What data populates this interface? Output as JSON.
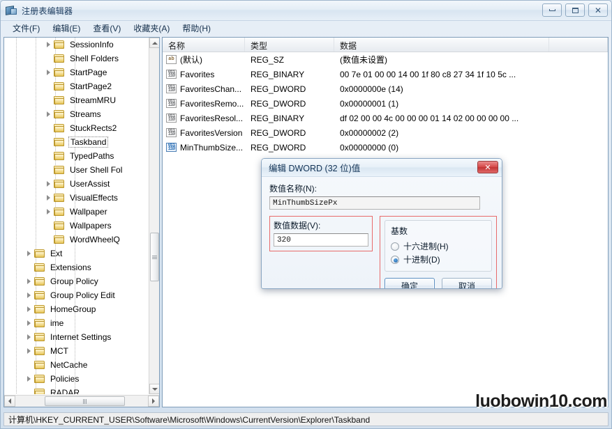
{
  "window": {
    "title": "注册表编辑器",
    "icon": "registry-editor-icon",
    "buttons": {
      "minimize": "–",
      "maximize": "❐",
      "close": "✕"
    }
  },
  "menu": [
    {
      "label": "文件(F)"
    },
    {
      "label": "编辑(E)"
    },
    {
      "label": "查看(V)"
    },
    {
      "label": "收藏夹(A)"
    },
    {
      "label": "帮助(H)"
    }
  ],
  "tree": {
    "items": [
      {
        "label": "SessionInfo",
        "indent": 2,
        "expandable": true,
        "selected": false
      },
      {
        "label": "Shell Folders",
        "indent": 2,
        "expandable": false,
        "selected": false
      },
      {
        "label": "StartPage",
        "indent": 2,
        "expandable": true,
        "selected": false
      },
      {
        "label": "StartPage2",
        "indent": 2,
        "expandable": false,
        "selected": false
      },
      {
        "label": "StreamMRU",
        "indent": 2,
        "expandable": false,
        "selected": false
      },
      {
        "label": "Streams",
        "indent": 2,
        "expandable": true,
        "selected": false
      },
      {
        "label": "StuckRects2",
        "indent": 2,
        "expandable": false,
        "selected": false
      },
      {
        "label": "Taskband",
        "indent": 2,
        "expandable": false,
        "selected": true
      },
      {
        "label": "TypedPaths",
        "indent": 2,
        "expandable": false,
        "selected": false
      },
      {
        "label": "User Shell Fol",
        "indent": 2,
        "expandable": false,
        "selected": false
      },
      {
        "label": "UserAssist",
        "indent": 2,
        "expandable": true,
        "selected": false
      },
      {
        "label": "VisualEffects",
        "indent": 2,
        "expandable": true,
        "selected": false
      },
      {
        "label": "Wallpaper",
        "indent": 2,
        "expandable": true,
        "selected": false
      },
      {
        "label": "Wallpapers",
        "indent": 2,
        "expandable": false,
        "selected": false
      },
      {
        "label": "WordWheelQ",
        "indent": 2,
        "expandable": false,
        "selected": false
      },
      {
        "label": "Ext",
        "indent": 1,
        "expandable": true,
        "selected": false
      },
      {
        "label": "Extensions",
        "indent": 1,
        "expandable": false,
        "selected": false
      },
      {
        "label": "Group Policy",
        "indent": 1,
        "expandable": true,
        "selected": false
      },
      {
        "label": "Group Policy Edit",
        "indent": 1,
        "expandable": true,
        "selected": false
      },
      {
        "label": "HomeGroup",
        "indent": 1,
        "expandable": true,
        "selected": false
      },
      {
        "label": "ime",
        "indent": 1,
        "expandable": true,
        "selected": false
      },
      {
        "label": "Internet Settings",
        "indent": 1,
        "expandable": true,
        "selected": false
      },
      {
        "label": "MCT",
        "indent": 1,
        "expandable": true,
        "selected": false
      },
      {
        "label": "NetCache",
        "indent": 1,
        "expandable": false,
        "selected": false
      },
      {
        "label": "Policies",
        "indent": 1,
        "expandable": true,
        "selected": false
      },
      {
        "label": "RADAR",
        "indent": 1,
        "expandable": false,
        "selected": false
      }
    ]
  },
  "list": {
    "columns": [
      "名称",
      "类型",
      "数据"
    ],
    "rows": [
      {
        "name": "(默认)",
        "icon": "string-value-icon",
        "type": "REG_SZ",
        "data": "(数值未设置)",
        "highlight": false
      },
      {
        "name": "Favorites",
        "icon": "binary-value-icon",
        "type": "REG_BINARY",
        "data": "00 7e 01 00 00 14 00 1f 80 c8 27 34 1f 10 5c ...",
        "highlight": false
      },
      {
        "name": "FavoritesChan...",
        "icon": "binary-value-icon",
        "type": "REG_DWORD",
        "data": "0x0000000e (14)",
        "highlight": false
      },
      {
        "name": "FavoritesRemo...",
        "icon": "binary-value-icon",
        "type": "REG_DWORD",
        "data": "0x00000001 (1)",
        "highlight": false
      },
      {
        "name": "FavoritesResol...",
        "icon": "binary-value-icon",
        "type": "REG_BINARY",
        "data": "df 02 00 00 4c 00 00 00 01 14 02 00 00 00 00 ...",
        "highlight": false
      },
      {
        "name": "FavoritesVersion",
        "icon": "binary-value-icon",
        "type": "REG_DWORD",
        "data": "0x00000002 (2)",
        "highlight": false
      },
      {
        "name": "MinThumbSize...",
        "icon": "binary-value-icon",
        "type": "REG_DWORD",
        "data": "0x00000000 (0)",
        "highlight": true
      }
    ]
  },
  "dialog": {
    "title": "编辑 DWORD (32 位)值",
    "close_label": "✕",
    "value_name_label": "数值名称(N):",
    "value_name": "MinThumbSizePx",
    "value_data_label": "数值数据(V):",
    "value_data": "320",
    "base_label": "基数",
    "base_options": [
      {
        "label": "十六进制(H)",
        "selected": false
      },
      {
        "label": "十进制(D)",
        "selected": true
      }
    ],
    "ok_label": "确定",
    "cancel_label": "取消",
    "annotation_color": "#e86a6a"
  },
  "statusbar": {
    "path": "计算机\\HKEY_CURRENT_USER\\Software\\Microsoft\\Windows\\CurrentVersion\\Explorer\\Taskband"
  },
  "watermark": {
    "text": "luobowin10.com"
  }
}
